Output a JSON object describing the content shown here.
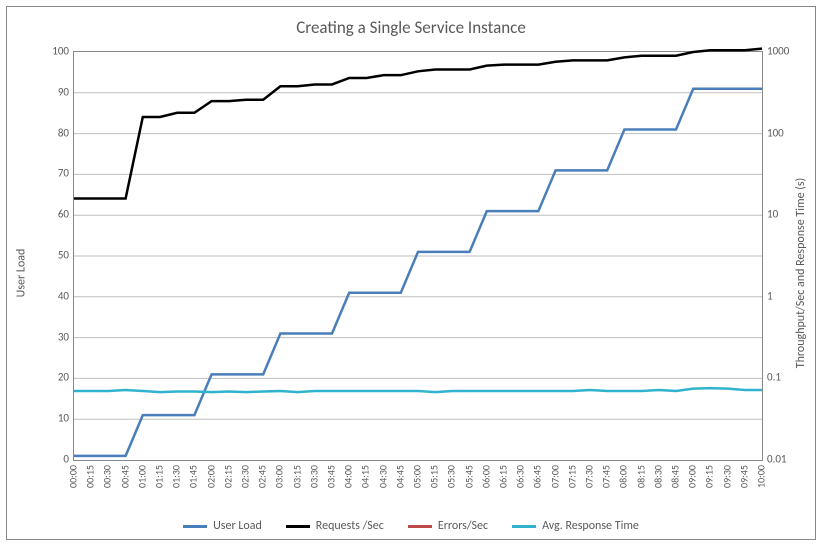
{
  "title": "Creating a Single Service Instance",
  "axes": {
    "left": {
      "label": "User Load"
    },
    "right": {
      "label": "Throughput/Sec and Response Time (s)"
    }
  },
  "legend": [
    {
      "name": "User Load",
      "color": "#4a7ebb"
    },
    {
      "name": "Requests /Sec",
      "color": "#000000"
    },
    {
      "name": "Errors/Sec",
      "color": "#be4b48"
    },
    {
      "name": "Avg. Response Time",
      "color": "#31b2cf"
    }
  ],
  "chart_data": {
    "type": "line",
    "title": "Creating a Single Service Instance",
    "xlabel": "",
    "ylabel_left": "User Load",
    "ylabel_right": "Throughput/Sec and Response Time (s)",
    "ylim_left": [
      0,
      100
    ],
    "yticks_left": [
      0,
      10,
      20,
      30,
      40,
      50,
      60,
      70,
      80,
      90,
      100
    ],
    "ylim_right_log": [
      0.01,
      1000
    ],
    "yticks_right": [
      0.01,
      0.1,
      1,
      10,
      100,
      1000
    ],
    "categories": [
      "00:00",
      "00:15",
      "00:30",
      "00:45",
      "01:00",
      "01:15",
      "01:30",
      "01:45",
      "02:00",
      "02:15",
      "02:30",
      "02:45",
      "03:00",
      "03:15",
      "03:30",
      "03:45",
      "04:00",
      "04:15",
      "04:30",
      "04:45",
      "05:00",
      "05:15",
      "05:30",
      "05:45",
      "06:00",
      "06:15",
      "06:30",
      "06:45",
      "07:00",
      "07:15",
      "07:30",
      "07:45",
      "08:00",
      "08:15",
      "08:30",
      "08:45",
      "09:00",
      "09:15",
      "09:30",
      "09:45",
      "10:00"
    ],
    "series": [
      {
        "name": "User Load",
        "axis": "left",
        "color": "#4a7ebb",
        "values": [
          1,
          1,
          1,
          1,
          11,
          11,
          11,
          11,
          21,
          21,
          21,
          21,
          31,
          31,
          31,
          31,
          41,
          41,
          41,
          41,
          51,
          51,
          51,
          51,
          61,
          61,
          61,
          61,
          71,
          71,
          71,
          71,
          81,
          81,
          81,
          81,
          91,
          91,
          91,
          91,
          91
        ]
      },
      {
        "name": "Requests /Sec",
        "axis": "right",
        "color": "#000000",
        "values": [
          16,
          16,
          16,
          16,
          160,
          160,
          180,
          180,
          250,
          250,
          260,
          260,
          380,
          380,
          400,
          400,
          480,
          480,
          520,
          520,
          580,
          610,
          610,
          610,
          680,
          700,
          700,
          700,
          760,
          790,
          790,
          790,
          860,
          900,
          900,
          900,
          1000,
          1050,
          1050,
          1050,
          1100
        ]
      },
      {
        "name": "Errors/Sec",
        "axis": "right",
        "color": "#be4b48",
        "values": [
          null,
          null,
          null,
          null,
          null,
          null,
          null,
          null,
          null,
          null,
          null,
          null,
          null,
          null,
          null,
          null,
          null,
          null,
          null,
          null,
          null,
          null,
          null,
          null,
          null,
          null,
          null,
          null,
          null,
          null,
          null,
          null,
          null,
          null,
          null,
          null,
          null,
          null,
          null,
          null,
          null
        ]
      },
      {
        "name": "Avg. Response Time",
        "axis": "right",
        "color": "#31b2cf",
        "values": [
          0.07,
          0.07,
          0.07,
          0.072,
          0.07,
          0.068,
          0.069,
          0.069,
          0.068,
          0.069,
          0.068,
          0.069,
          0.07,
          0.068,
          0.07,
          0.07,
          0.07,
          0.07,
          0.07,
          0.07,
          0.07,
          0.068,
          0.07,
          0.07,
          0.07,
          0.07,
          0.07,
          0.07,
          0.07,
          0.07,
          0.072,
          0.07,
          0.07,
          0.07,
          0.072,
          0.07,
          0.075,
          0.076,
          0.075,
          0.072,
          0.072
        ]
      }
    ]
  }
}
